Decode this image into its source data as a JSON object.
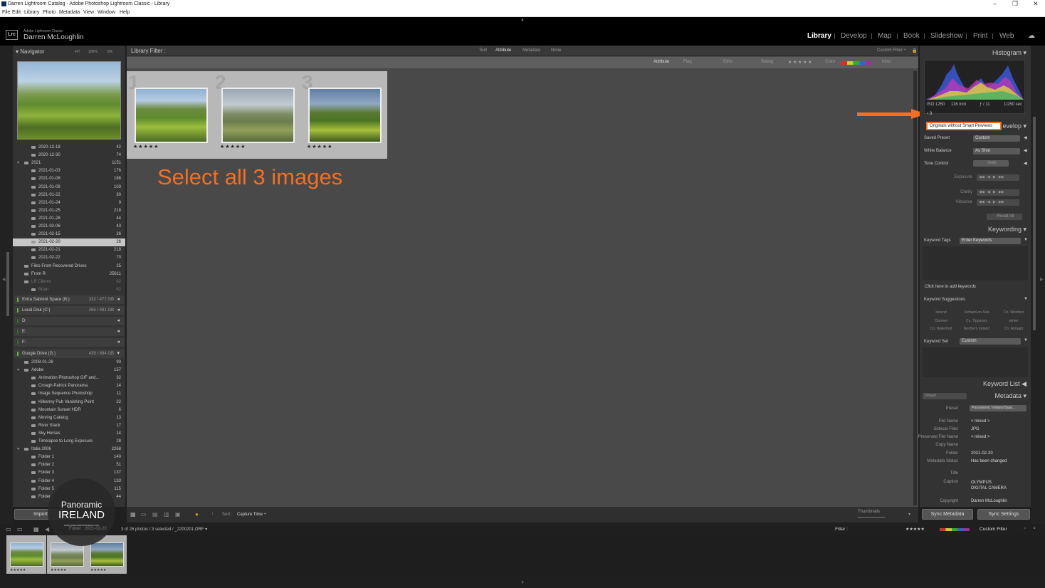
{
  "window": {
    "title": "Darren Lightroom Catalog - Adobe Photoshop Lightroom Classic - Library",
    "controls": [
      "–",
      "❐",
      "✕"
    ]
  },
  "menu": [
    "File",
    "Edit",
    "Library",
    "Photo",
    "Metadata",
    "View",
    "Window",
    "Help"
  ],
  "identity": {
    "product": "Adobe Lightroom Classic",
    "name": "Darren McLoughlin",
    "logo": "Lrc"
  },
  "modules": [
    "Library",
    "Develop",
    "Map",
    "Book",
    "Slideshow",
    "Print",
    "Web"
  ],
  "navigator": {
    "title": "Navigator",
    "zoom": [
      "FIT",
      "100%",
      "8%"
    ]
  },
  "folders": [
    {
      "name": "2020-12-18",
      "count": "42",
      "level": 2
    },
    {
      "name": "2020-12-30",
      "count": "74",
      "level": 2
    },
    {
      "name": "2021",
      "count": "1151",
      "level": 1,
      "open": true
    },
    {
      "name": "2021-01-03",
      "count": "176",
      "level": 2
    },
    {
      "name": "2021-01-08",
      "count": "188",
      "level": 2
    },
    {
      "name": "2021-01-09",
      "count": "103",
      "level": 2
    },
    {
      "name": "2021-01-22",
      "count": "30",
      "level": 2
    },
    {
      "name": "2021-01-24",
      "count": "9",
      "level": 2
    },
    {
      "name": "2021-01-25",
      "count": "218",
      "level": 2
    },
    {
      "name": "2021-01-28",
      "count": "44",
      "level": 2
    },
    {
      "name": "2021-02-06",
      "count": "43",
      "level": 2
    },
    {
      "name": "2021-02-15",
      "count": "26",
      "level": 2
    },
    {
      "name": "2021-02-20",
      "count": "26",
      "level": 2,
      "selected": true
    },
    {
      "name": "2021-02-21",
      "count": "218",
      "level": 2
    },
    {
      "name": "2021-02-22",
      "count": "70",
      "level": 2
    },
    {
      "name": "Files From Recovered Drives",
      "count": "25",
      "level": 1
    },
    {
      "name": "From R",
      "count": "25611",
      "level": 1
    },
    {
      "name": "LR Clients",
      "count": "62",
      "level": 1,
      "dim": true
    },
    {
      "name": "Brian",
      "count": "62",
      "level": 2,
      "dim": true
    }
  ],
  "volumes": [
    {
      "name": "Extra Sabrent Space (B:)",
      "size": "332 / 477 GB"
    },
    {
      "name": "Local Disk (C:)",
      "size": "265 / 481 GB"
    },
    {
      "name": "D:",
      "size": ""
    },
    {
      "name": "E:",
      "size": ""
    },
    {
      "name": "F:",
      "size": ""
    },
    {
      "name": "Google Drive (G:)",
      "size": "439 / 894 GB"
    }
  ],
  "folders2": [
    {
      "name": "2008-01-28",
      "count": "93",
      "level": 1
    },
    {
      "name": "Adobe",
      "count": "157",
      "level": 1,
      "open": true
    },
    {
      "name": "Animation Photoshop GIF and...",
      "count": "32",
      "level": 2
    },
    {
      "name": "Croagh Patrick Panorama",
      "count": "14",
      "level": 2
    },
    {
      "name": "Image Sequence Photoshop",
      "count": "11",
      "level": 2
    },
    {
      "name": "Kilkenny Pub Vanishing Point",
      "count": "22",
      "level": 2
    },
    {
      "name": "Mountain Sunset HDR",
      "count": "6",
      "level": 2
    },
    {
      "name": "Moving Catalog",
      "count": "13",
      "level": 2
    },
    {
      "name": "River Stack",
      "count": "17",
      "level": 2
    },
    {
      "name": "Sky Horses",
      "count": "14",
      "level": 2
    },
    {
      "name": "Timelapse to Long Exposure",
      "count": "28",
      "level": 2
    },
    {
      "name": "Italia 2006",
      "count": "2268",
      "level": 1,
      "open": true
    },
    {
      "name": "Folder 1",
      "count": "140",
      "level": 2
    },
    {
      "name": "Folder 2",
      "count": "51",
      "level": 2
    },
    {
      "name": "Folder 3",
      "count": "137",
      "level": 2
    },
    {
      "name": "Folder 4",
      "count": "133",
      "level": 2
    },
    {
      "name": "Folder 5",
      "count": "115",
      "level": 2
    },
    {
      "name": "Folder",
      "count": "44",
      "level": 2
    }
  ],
  "import_label": "Import",
  "watermark": {
    "line1": "Panoramic",
    "line2": "IRELAND",
    "url": "www.panoramicireland.com"
  },
  "filter": {
    "title": "Library Filter :",
    "tabs": [
      "Text",
      "Attribute",
      "Metadata",
      "None"
    ],
    "active": "Attribute",
    "preset": "Custom Filter ÷",
    "attr_items": [
      "Attribute",
      "Flag",
      "Edits",
      "Rating",
      "★ ★ ★ ★ ★",
      "Color",
      "Kind"
    ]
  },
  "grid": [
    {
      "num": "1",
      "stars": "★★★★★"
    },
    {
      "num": "2",
      "stars": "★★★★★"
    },
    {
      "num": "3",
      "stars": "★★★★★"
    }
  ],
  "annotation": "Select all 3 images",
  "toolbar": {
    "sort_label": "Sort :",
    "sort_value": "Capture Time ÷",
    "thumbs": "Thumbnails"
  },
  "histogram": {
    "title": "Histogram",
    "iso": "ISO 1250",
    "focal": "116 mm",
    "aperture": "ƒ / 11",
    "shutter": "1/250 sec",
    "count": "3",
    "tooltip": "Originals without Smart Previews"
  },
  "quick_develop": {
    "title": "Quick Develop",
    "title_visible": "evelop",
    "saved_preset_label": "Saved Preset",
    "saved_preset": "Custom",
    "wb_label": "White Balance",
    "wb": "As Shot",
    "tone_label": "Tone Control",
    "auto": "Auto",
    "exposure": "Exposure",
    "clarity": "Clarity",
    "vibrance": "Vibrance",
    "reset": "Reset All"
  },
  "keywording": {
    "title": "Keywording",
    "tags_label": "Keyword Tags",
    "tags_value": "Enter Keywords",
    "hint": "Click here to add keywords",
    "suggestions_label": "Keyword Suggestions",
    "suggestions": [
      "Ireland",
      "Fethard-on-Sea",
      "Co. Wexford",
      "Clonmel",
      "Co. Tipperary",
      "winter",
      "Co. Waterford",
      "Northern Ireland",
      "Co. Armagh"
    ],
    "set_label": "Keyword Set",
    "set_value": "Custom"
  },
  "keyword_list": {
    "title": "Keyword List"
  },
  "metadata": {
    "title": "Metadata",
    "default": "Default",
    "preset_label": "Preset",
    "preset": "Panoramic Ireland Basi...",
    "fields": [
      {
        "label": "File Name",
        "value": "< mixed >"
      },
      {
        "label": "Sidecar Files",
        "value": "JPG"
      },
      {
        "label": "Preserved File Name",
        "value": "< mixed >"
      },
      {
        "label": "Copy Name",
        "value": ""
      },
      {
        "label": "Folder",
        "value": "2021-02-20"
      },
      {
        "label": "Metadata Status",
        "value": "Has been changed"
      },
      {
        "label": "Title",
        "value": ""
      },
      {
        "label": "Caption",
        "value": "OLYMPUS DIGITAL CAMERA"
      },
      {
        "label": "Copyright",
        "value": "Darren McLoughlin"
      }
    ]
  },
  "sync_metadata": "Sync Metadata",
  "sync_settings": "Sync Settings",
  "filmstrip": {
    "status": "3 of 26 photos / 3 selected / _2200201.ORF ▾",
    "folder": "Folder : 2021-02-20",
    "filter_label": "Filter :",
    "stars": "★★★★★",
    "custom": "Custom Filter"
  },
  "colors": {
    "accent": "#f36f21",
    "panel": "#333333",
    "grid": "#494949"
  }
}
